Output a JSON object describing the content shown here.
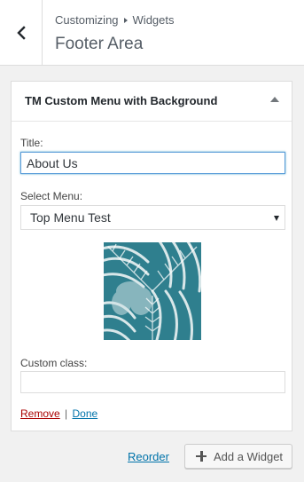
{
  "header": {
    "breadcrumb": {
      "root": "Customizing",
      "current": "Widgets"
    },
    "title": "Footer Area",
    "back_icon": "chevron-left-icon"
  },
  "widget": {
    "title": "TM Custom Menu with Background",
    "toggle_icon": "caret-up-icon",
    "fields": {
      "title_label": "Title:",
      "title_value": "About Us",
      "menu_label": "Select Menu:",
      "menu_selected": "Top Menu Test",
      "custom_class_label": "Custom class:",
      "custom_class_value": ""
    },
    "actions": {
      "remove": "Remove",
      "separator": "|",
      "done": "Done"
    }
  },
  "footer": {
    "reorder": "Reorder",
    "add_widget": "Add a Widget",
    "add_icon": "plus-icon"
  },
  "colors": {
    "link": "#0073aa",
    "remove": "#aa0000",
    "focus": "#5b9dd9",
    "image_teal": "#2f7f8e"
  }
}
